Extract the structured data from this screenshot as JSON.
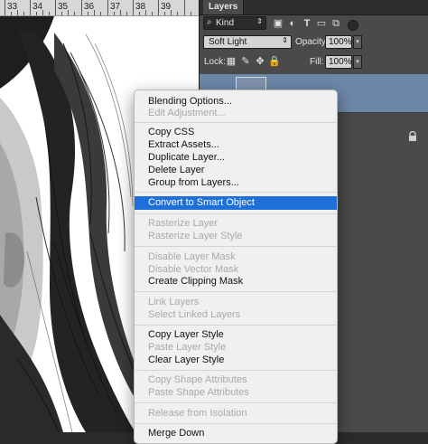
{
  "ruler": {
    "numbers": [
      "33",
      "34",
      "35",
      "36",
      "37",
      "38",
      "39"
    ]
  },
  "panel": {
    "tab_label": "Layers",
    "filter": {
      "icon": "search-icon",
      "value": "Kind"
    },
    "filter_icons": [
      "image-filter-icon",
      "adjustment-filter-icon",
      "type-filter-icon",
      "shape-filter-icon",
      "smart-object-filter-icon"
    ],
    "blend_mode": "Soft Light",
    "opacity_label": "Opacity:",
    "opacity_value": "100%",
    "lock_label": "Lock:",
    "fill_label": "Fill:",
    "fill_value": "100%"
  },
  "menu": {
    "items": [
      {
        "label": "Blending Options...",
        "enabled": true
      },
      {
        "label": "Edit Adjustment...",
        "enabled": false
      },
      {
        "label": "Copy CSS",
        "enabled": true
      },
      {
        "label": "Extract Assets...",
        "enabled": true
      },
      {
        "label": "Duplicate Layer...",
        "enabled": true
      },
      {
        "label": "Delete Layer",
        "enabled": true
      },
      {
        "label": "Group from Layers...",
        "enabled": true
      },
      {
        "label": "Convert to Smart Object",
        "enabled": true,
        "selected": true
      },
      {
        "label": "Rasterize Layer",
        "enabled": false
      },
      {
        "label": "Rasterize Layer Style",
        "enabled": false
      },
      {
        "label": "Disable Layer Mask",
        "enabled": false
      },
      {
        "label": "Disable Vector Mask",
        "enabled": false
      },
      {
        "label": "Create Clipping Mask",
        "enabled": true
      },
      {
        "label": "Link Layers",
        "enabled": false
      },
      {
        "label": "Select Linked Layers",
        "enabled": false
      },
      {
        "label": "Copy Layer Style",
        "enabled": true
      },
      {
        "label": "Paste Layer Style",
        "enabled": false
      },
      {
        "label": "Clear Layer Style",
        "enabled": true
      },
      {
        "label": "Copy Shape Attributes",
        "enabled": false
      },
      {
        "label": "Paste Shape Attributes",
        "enabled": false
      },
      {
        "label": "Release from Isolation",
        "enabled": false
      },
      {
        "label": "Merge Down",
        "enabled": true
      }
    ]
  },
  "colors": {
    "selection": "#1f6fd8",
    "layer_selected": "#6d87a8",
    "panel_bg": "#4a4a4a"
  }
}
